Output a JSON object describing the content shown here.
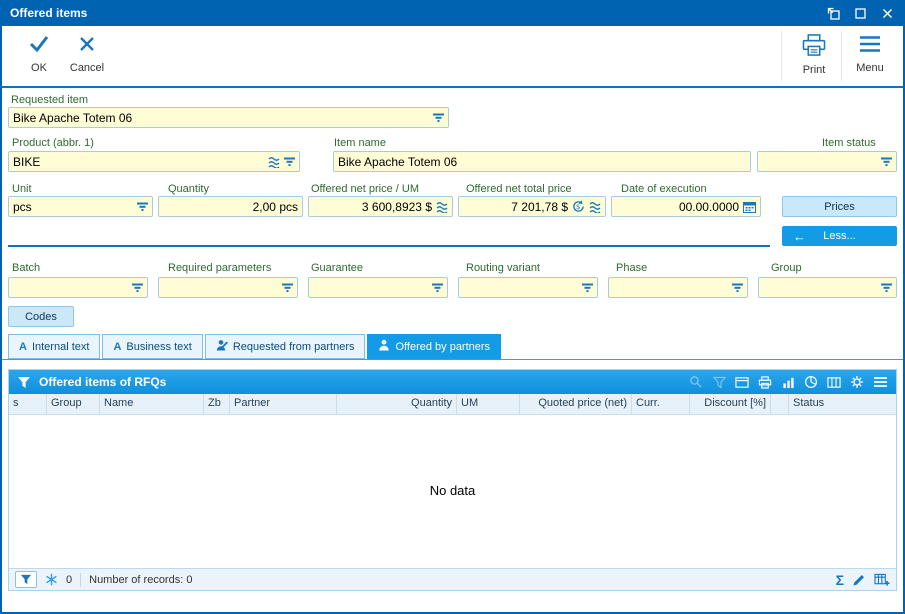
{
  "window": {
    "title": "Offered items"
  },
  "toolbar": {
    "ok_label": "OK",
    "cancel_label": "Cancel",
    "print_label": "Print",
    "menu_label": "Menu"
  },
  "form": {
    "requested_item": {
      "label": "Requested item",
      "value": "Bike Apache Totem 06"
    },
    "product": {
      "label": "Product (abbr. 1)",
      "value": "BIKE"
    },
    "item_name": {
      "label": "Item name",
      "value": "Bike Apache Totem 06"
    },
    "item_status": {
      "label": "Item status",
      "value": ""
    },
    "unit": {
      "label": "Unit",
      "value": "pcs"
    },
    "quantity": {
      "label": "Quantity",
      "value": "2,00 pcs"
    },
    "offered_net_price_um": {
      "label": "Offered net price / UM",
      "value": "3 600,8923 $"
    },
    "offered_net_total_price": {
      "label": "Offered net total price",
      "value": "7 201,78 $"
    },
    "date_of_execution": {
      "label": "Date of execution",
      "value": "00.00.0000"
    },
    "prices_button": "Prices",
    "less_button": "Less...",
    "batch": {
      "label": "Batch",
      "value": ""
    },
    "required_parameters": {
      "label": "Required parameters",
      "value": ""
    },
    "guarantee": {
      "label": "Guarantee",
      "value": ""
    },
    "routing_variant": {
      "label": "Routing variant",
      "value": ""
    },
    "phase": {
      "label": "Phase",
      "value": ""
    },
    "group": {
      "label": "Group",
      "value": ""
    },
    "codes_button": "Codes"
  },
  "tabs": [
    {
      "label": "Internal text",
      "active": false
    },
    {
      "label": "Business text",
      "active": false
    },
    {
      "label": "Requested from partners",
      "active": false
    },
    {
      "label": "Offered by partners",
      "active": true
    }
  ],
  "panel": {
    "title": "Offered items of RFQs",
    "columns": [
      "s",
      "Group",
      "Name",
      "Zb",
      "Partner",
      "Quantity",
      "UM",
      "Quoted price (net)",
      "Curr.",
      "Discount [%]",
      "",
      "Status"
    ],
    "no_data": "No data",
    "status": {
      "count": "0",
      "records": "Number of records: 0"
    }
  },
  "icons": {
    "sigma": "Σ",
    "text_tab": "A",
    "back_arrow": "←"
  },
  "colors": {
    "titlebar": "#0063B1",
    "accent": "#149BE5",
    "field_bg": "#FFFDD6",
    "label_green": "#2F6A2F",
    "toolbar_icon_blue": "#1977C0"
  }
}
